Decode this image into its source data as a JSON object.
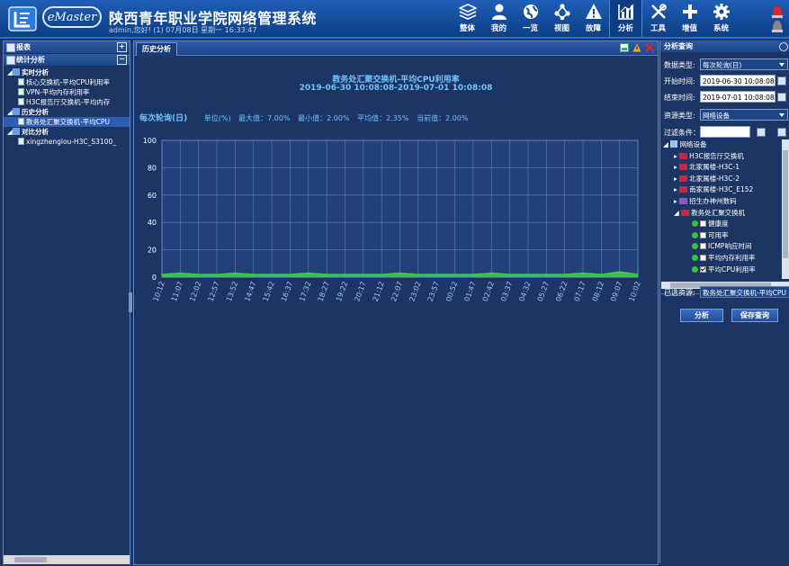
{
  "header": {
    "logo_text": "eMaster",
    "app_title": "陕西青年职业学院网络管理系统",
    "user_info": "admin,您好! (1) 07月08日 星期一 16:33:47",
    "nav": [
      {
        "label": "整体",
        "icon": "layers-icon"
      },
      {
        "label": "我的",
        "icon": "user-icon"
      },
      {
        "label": "一览",
        "icon": "globe-icon"
      },
      {
        "label": "视图",
        "icon": "topology-icon"
      },
      {
        "label": "故障",
        "icon": "warning-icon"
      },
      {
        "label": "分析",
        "icon": "bar-chart-icon",
        "active": true
      },
      {
        "label": "工具",
        "icon": "tools-icon"
      },
      {
        "label": "增值",
        "icon": "plus-icon"
      },
      {
        "label": "系统",
        "icon": "gear-icon"
      }
    ]
  },
  "left_panel": {
    "reports_title": "报表",
    "stats_title": "统计分析",
    "tree": [
      {
        "kind": "cat",
        "label": "实时分析"
      },
      {
        "kind": "leaf",
        "label": "核心交换机-平均CPU利用率"
      },
      {
        "kind": "leaf",
        "label": "VPN-平均内存利用率"
      },
      {
        "kind": "leaf",
        "label": "H3C报告厅交换机-平均内存"
      },
      {
        "kind": "cat",
        "label": "历史分析"
      },
      {
        "kind": "leaf",
        "label": "教务处汇聚交换机-平均CPU",
        "selected": true
      },
      {
        "kind": "cat",
        "label": "对比分析"
      },
      {
        "kind": "leaf",
        "label": "xingzhenglou-H3C_S3100_"
      }
    ]
  },
  "center": {
    "tab_label": "历史分析",
    "chart_title": "教务处汇聚交换机-平均CPU利用率",
    "chart_range": "2019-06-30 10:08:08-2019-07-01 10:08:08",
    "mode": "每次轮询(日)",
    "unit": "单位(%)",
    "stats": {
      "max": "最大值：7.00%",
      "min": "最小值：2.00%",
      "avg": "平均值：2.35%",
      "current": "当前值：2.00%"
    }
  },
  "chart_data": {
    "type": "area",
    "title": "教务处汇聚交换机-平均CPU利用率",
    "ylim": [
      0,
      100
    ],
    "yticks": [
      0,
      20,
      40,
      60,
      80,
      100
    ],
    "grid": true,
    "color": "#3fd44a",
    "x": [
      "10:12",
      "11:07",
      "12:02",
      "12:57",
      "13:52",
      "14:47",
      "15:42",
      "16:37",
      "17:32",
      "18:27",
      "19:22",
      "20:17",
      "21:12",
      "22:07",
      "23:02",
      "23:57",
      "00:52",
      "01:47",
      "02:42",
      "03:37",
      "04:32",
      "05:27",
      "06:22",
      "07:17",
      "08:12",
      "09:07",
      "10:02"
    ],
    "values": [
      2,
      3,
      2,
      2,
      3,
      2,
      2,
      2,
      3,
      2,
      2,
      2,
      2,
      3,
      2,
      2,
      2,
      2,
      3,
      2,
      2,
      2,
      2,
      3,
      2,
      4,
      2
    ]
  },
  "right_panel": {
    "title": "分析查询",
    "data_type_label": "数据类型:",
    "data_type_value": "每次轮询(日)",
    "start_label": "开始时间:",
    "start_value": "2019-06-30 10:08:08",
    "end_label": "结束时间:",
    "end_value": "2019-07-01 10:08:08",
    "resource_type_label": "资源类型:",
    "resource_type_value": "网络设备",
    "filter_label": "过滤条件：",
    "tree_root": "网络设备",
    "devices": [
      "H3C报告厅交换机",
      "北家属楼-H3C-1",
      "北家属楼-H3C-2",
      "南家属楼-H3C_E152",
      "招生办神州数码",
      "教务处汇聚交换机"
    ],
    "metrics": [
      {
        "label": "健康度",
        "checked": false
      },
      {
        "label": "可用率",
        "checked": false
      },
      {
        "label": "ICMP响应时间",
        "checked": false
      },
      {
        "label": "平均内存利用率",
        "checked": false
      },
      {
        "label": "平均CPU利用率",
        "checked": true
      }
    ],
    "selected_label": "已选资源:",
    "selected_value": "教务处汇聚交换机-平均CPU",
    "analyze_button": "分析",
    "save_button": "保存查询"
  }
}
